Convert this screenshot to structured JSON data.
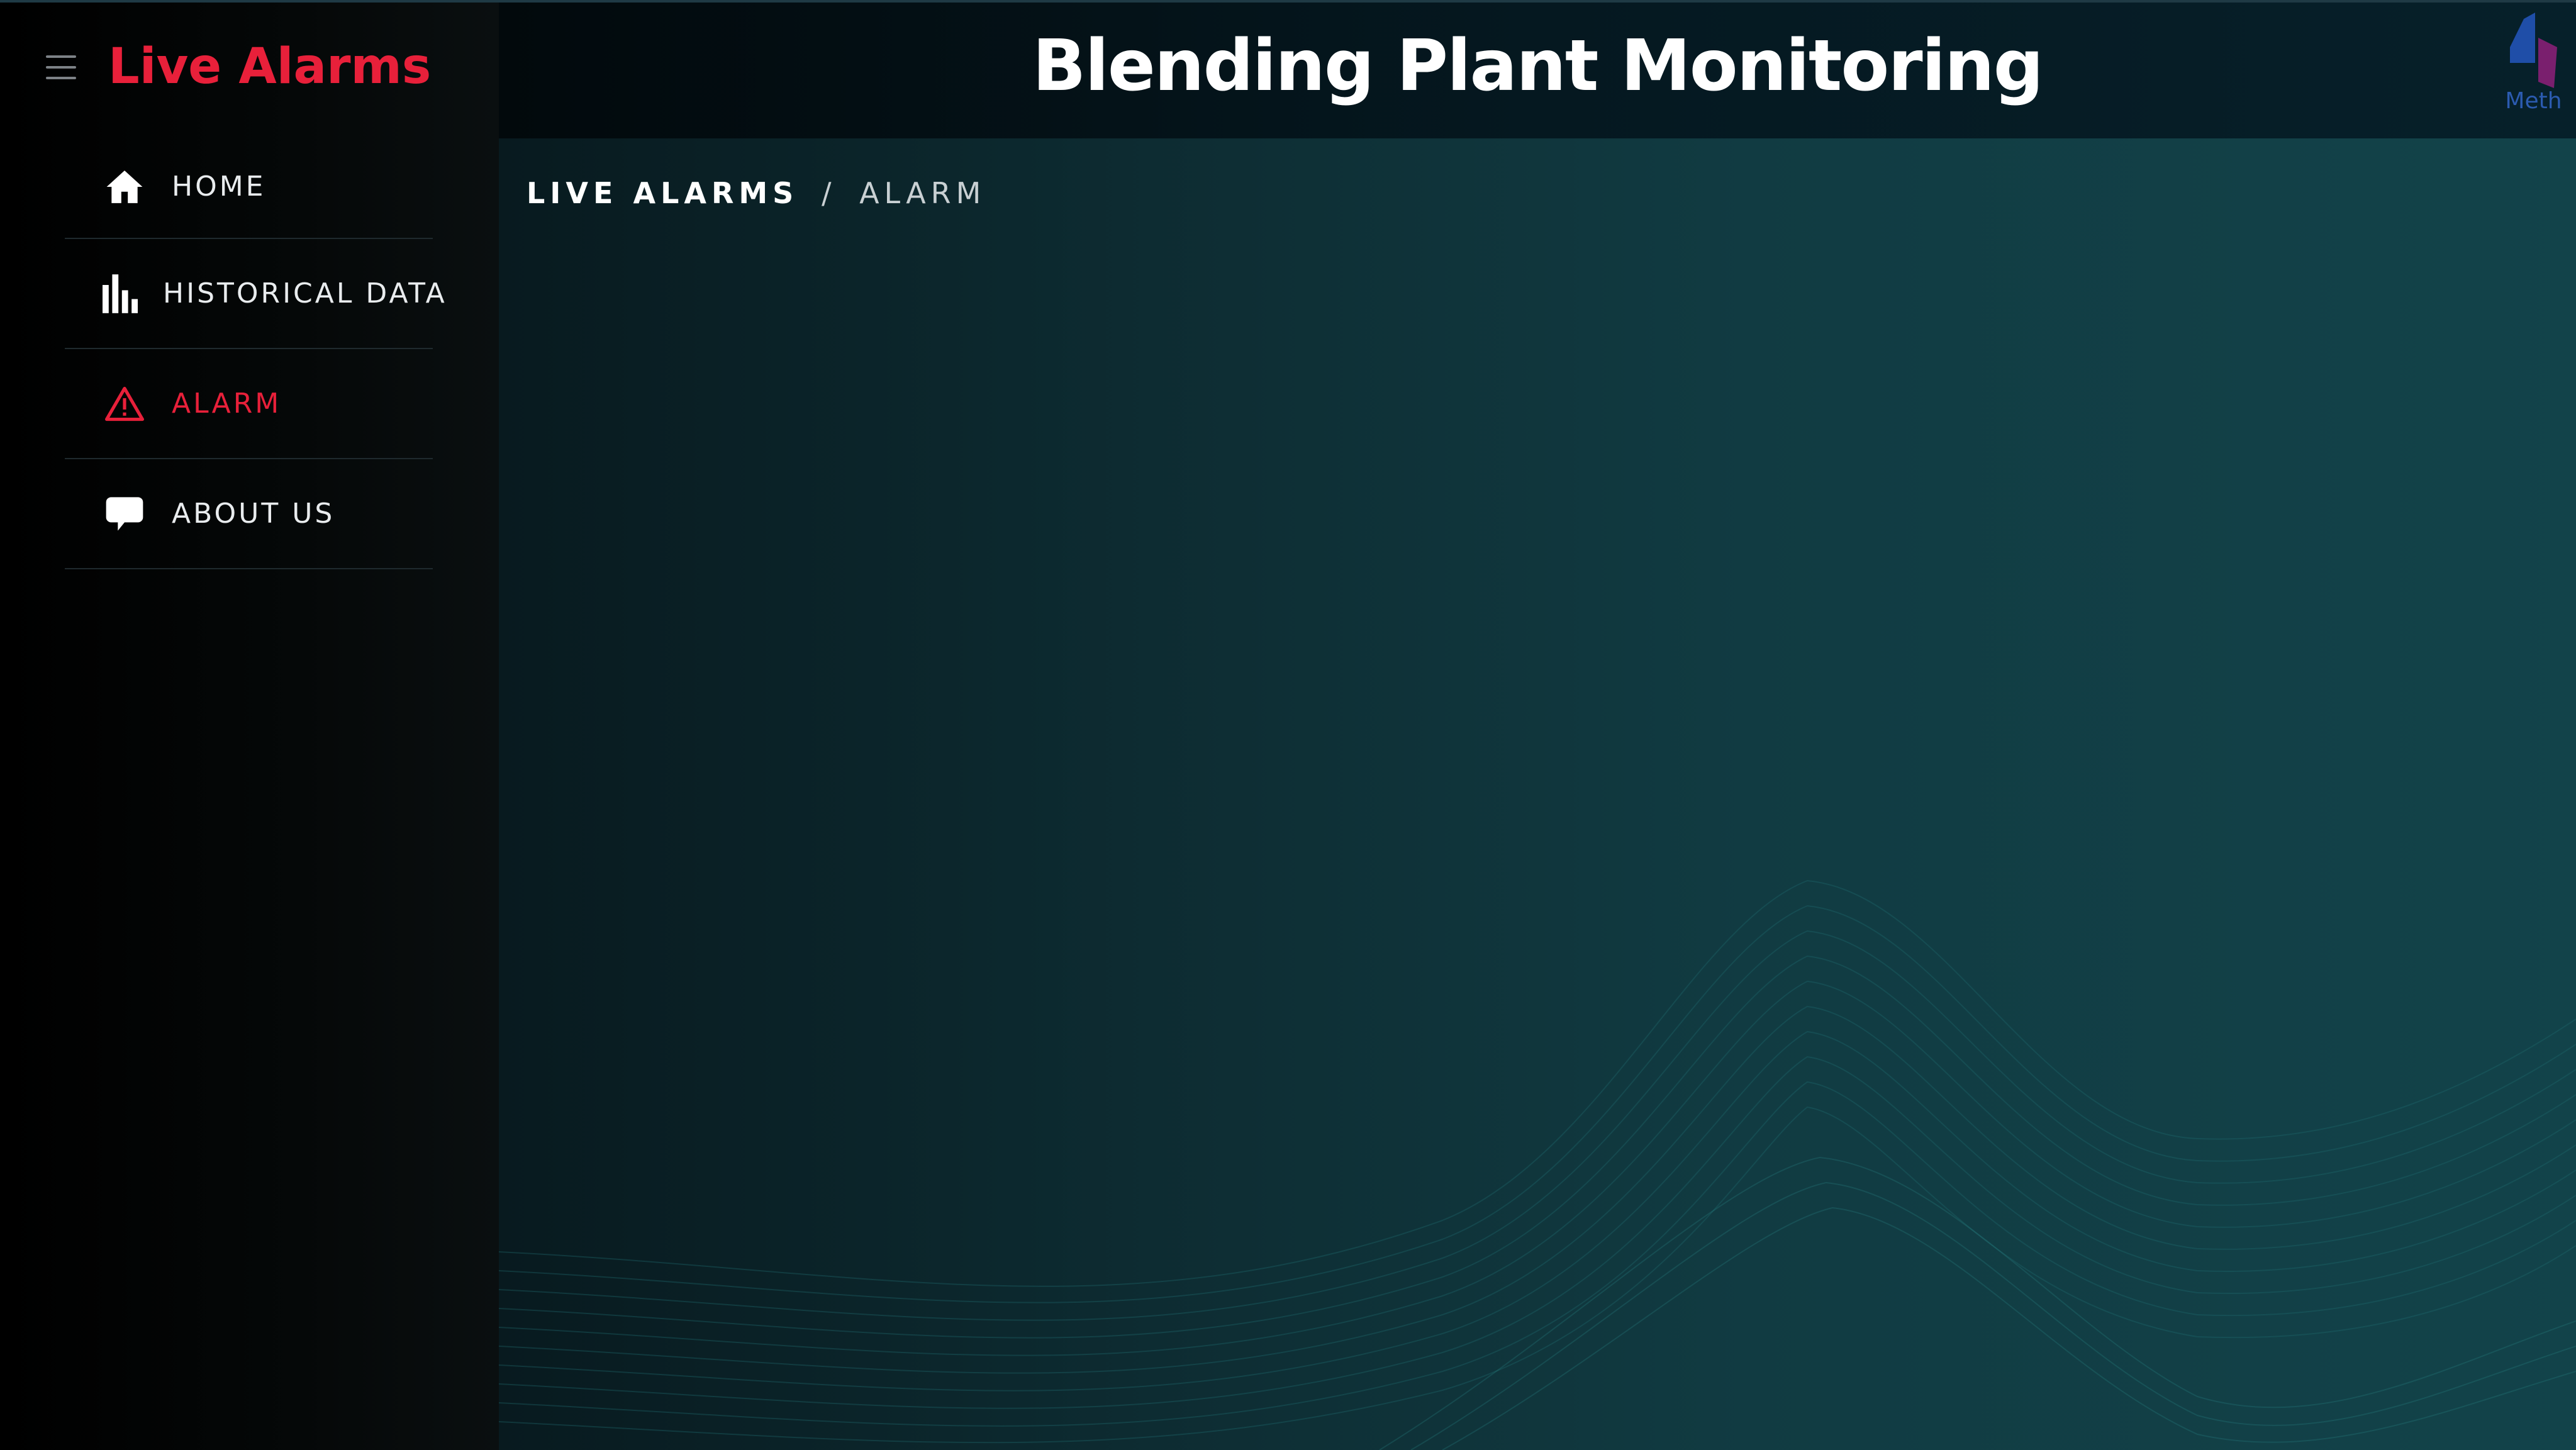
{
  "sidebar": {
    "brand": "Live Alarms",
    "items": [
      {
        "label": "HOME",
        "icon": "home-icon"
      },
      {
        "label": "HISTORICAL DATA",
        "icon": "bar-chart-icon"
      },
      {
        "label": "ALARM",
        "icon": "warning-icon",
        "active": true
      },
      {
        "label": "ABOUT US",
        "icon": "chat-bubble-icon"
      }
    ]
  },
  "header": {
    "title": "Blending Plant Monitoring",
    "logo_text": "Meth"
  },
  "breadcrumb": {
    "root": "LIVE ALARMS",
    "separator": "/",
    "current": "ALARM"
  },
  "colors": {
    "accent": "#e8203a",
    "sidebar_bg": "#000000",
    "main_bg_start": "#081a1f",
    "main_bg_end": "#12434a",
    "text": "#ffffff"
  }
}
